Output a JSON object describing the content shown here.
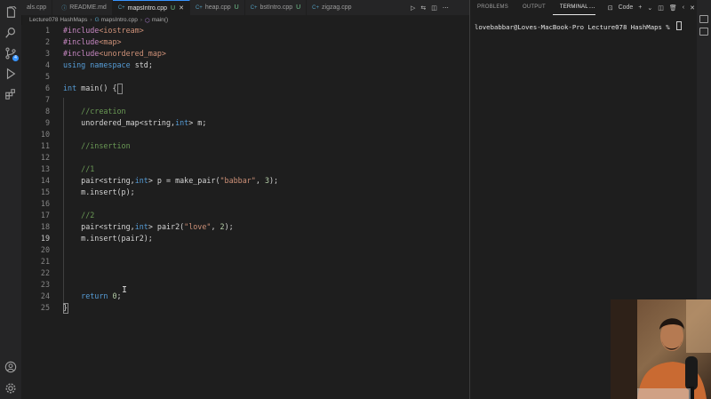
{
  "tabs": [
    {
      "label": "als.cpp",
      "icon": "cpp-file-icon",
      "modified": "",
      "active": false
    },
    {
      "label": "README.md",
      "icon": "info-icon",
      "modified": "",
      "active": false
    },
    {
      "label": "mapsIntro.cpp",
      "icon": "cpp-file-icon",
      "modified": "U",
      "active": true
    },
    {
      "label": "heap.cpp",
      "icon": "cpp-file-icon",
      "modified": "U",
      "active": false
    },
    {
      "label": "bstIntro.cpp",
      "icon": "cpp-file-icon",
      "modified": "U",
      "active": false
    },
    {
      "label": "zigzag.cpp",
      "icon": "cpp-file-icon",
      "modified": "",
      "active": false
    }
  ],
  "breadcrumb": {
    "folder": "Lecture078 HashMaps",
    "file": "mapsIntro.cpp",
    "symbol": "main()"
  },
  "editor": {
    "current_line": 19,
    "line_numbers": [
      "1",
      "2",
      "3",
      "4",
      "5",
      "6",
      "7",
      "8",
      "9",
      "10",
      "11",
      "12",
      "13",
      "14",
      "15",
      "16",
      "17",
      "18",
      "19",
      "20",
      "21",
      "22",
      "23",
      "24",
      "25"
    ],
    "lines": [
      [
        [
          "pp",
          "#include"
        ],
        [
          "str",
          "<iostream>"
        ]
      ],
      [
        [
          "pp",
          "#include"
        ],
        [
          "str",
          "<map>"
        ]
      ],
      [
        [
          "pp",
          "#include"
        ],
        [
          "str",
          "<unordered_map>"
        ]
      ],
      [
        [
          "kw",
          "using"
        ],
        [
          "p",
          " "
        ],
        [
          "kw",
          "namespace"
        ],
        [
          "p",
          " std;"
        ]
      ],
      [],
      [
        [
          "ty",
          "int"
        ],
        [
          "p",
          " main() {"
        ]
      ],
      [],
      [
        [
          "p",
          "    "
        ],
        [
          "cm",
          "//creation"
        ]
      ],
      [
        [
          "p",
          "    unordered_map<string,"
        ],
        [
          "ty",
          "int"
        ],
        [
          "p",
          "> m;"
        ]
      ],
      [],
      [
        [
          "p",
          "    "
        ],
        [
          "cm",
          "//insertion"
        ]
      ],
      [],
      [
        [
          "p",
          "    "
        ],
        [
          "cm",
          "//1"
        ]
      ],
      [
        [
          "p",
          "    pair<string,"
        ],
        [
          "ty",
          "int"
        ],
        [
          "p",
          "> p = make_pair("
        ],
        [
          "str",
          "\"babbar\""
        ],
        [
          "p",
          ", "
        ],
        [
          "num",
          "3"
        ],
        [
          "p",
          ");"
        ]
      ],
      [
        [
          "p",
          "    m.insert(p);"
        ]
      ],
      [],
      [
        [
          "p",
          "    "
        ],
        [
          "cm",
          "//2"
        ]
      ],
      [
        [
          "p",
          "    pair<string,"
        ],
        [
          "ty",
          "int"
        ],
        [
          "p",
          "> pair2("
        ],
        [
          "str",
          "\"love\""
        ],
        [
          "p",
          ", "
        ],
        [
          "num",
          "2"
        ],
        [
          "p",
          ");"
        ]
      ],
      [
        [
          "p",
          "    m.insert(pair2);"
        ]
      ],
      [],
      [],
      [],
      [],
      [
        [
          "p",
          "    "
        ],
        [
          "kw",
          "return"
        ],
        [
          "p",
          " "
        ],
        [
          "num",
          "0"
        ],
        [
          "p",
          ";"
        ]
      ],
      [
        [
          "p",
          "}"
        ]
      ]
    ]
  },
  "panel": {
    "tabs": [
      "PROBLEMS",
      "OUTPUT",
      "TERMINAL"
    ],
    "active_tab": "TERMINAL",
    "shell_label": "Code",
    "terminal_prompt": "lovebabbar@Loves-MacBook-Pro Lecture078 HashMaps % "
  },
  "activity_badge": "4",
  "colors": {
    "accent": "#3794ff",
    "keyword": "#569cd6",
    "string": "#ce9178",
    "comment": "#6a9955",
    "preprocessor": "#c586c0",
    "number": "#b5cea8",
    "untracked": "#73c991"
  }
}
